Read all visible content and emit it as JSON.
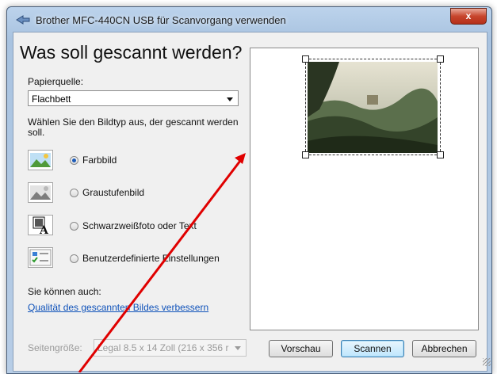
{
  "window": {
    "title": "Brother MFC-440CN USB für Scanvorgang verwenden",
    "close_label": "x"
  },
  "main": {
    "heading": "Was soll gescannt werden?",
    "paper_source_label": "Papierquelle:",
    "paper_source_value": "Flachbett",
    "image_type_prompt": "Wählen Sie den Bildtyp aus, der gescannt werden soll.",
    "options": [
      {
        "label": "Farbbild",
        "selected": true,
        "icon": "color-picture-icon"
      },
      {
        "label": "Graustufenbild",
        "selected": false,
        "icon": "grayscale-picture-icon"
      },
      {
        "label": "Schwarzweißfoto oder Text",
        "selected": false,
        "icon": "bw-text-icon"
      },
      {
        "label": "Benutzerdefinierte Einstellungen",
        "selected": false,
        "icon": "custom-settings-icon"
      }
    ],
    "also_label": "Sie können auch:",
    "improve_link": "Qualität des gescannten Bildes verbessern",
    "page_size_label": "Seitengröße:",
    "page_size_value": "Legal 8.5 x 14 Zoll (216 x 356 r"
  },
  "buttons": {
    "preview": "Vorschau",
    "scan": "Scannen",
    "cancel": "Abbrechen"
  },
  "colors": {
    "accent": "#1d5bb8",
    "link": "#0f52ba",
    "annotation_arrow": "#e00000",
    "close_button": "#c7452c"
  }
}
